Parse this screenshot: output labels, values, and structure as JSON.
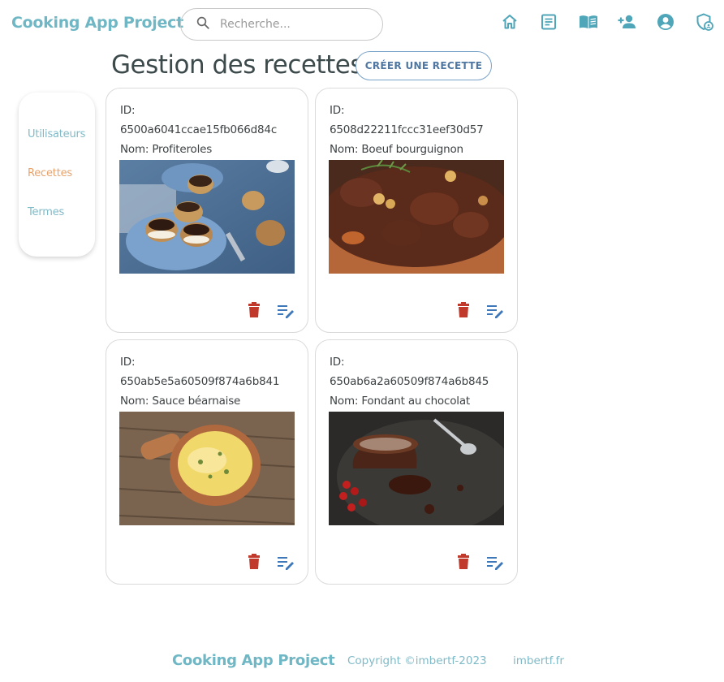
{
  "header": {
    "brand": "Cooking App Project",
    "search": {
      "placeholder": "Recherche..."
    },
    "nav_icons": [
      "home-icon",
      "article-icon",
      "recipe-book-icon",
      "add-user-icon",
      "account-icon",
      "admin-shield-icon"
    ]
  },
  "page": {
    "title": "Gestion des recettes",
    "create_button": "CRÉER UNE RECETTE"
  },
  "sidebar": {
    "items": [
      {
        "label": "Utilisateurs",
        "active": false
      },
      {
        "label": "Recettes",
        "active": true
      },
      {
        "label": "Termes",
        "active": false
      }
    ]
  },
  "recipes": [
    {
      "id_label": "ID:",
      "id": "6500a6041ccae15fb066d84c",
      "name": "Nom: Profiteroles"
    },
    {
      "id_label": "ID:",
      "id": "6508d22211fccc31eef30d57",
      "name": "Nom: Boeuf bourguignon"
    },
    {
      "id_label": "ID:",
      "id": "650ab5e5a60509f874a6b841",
      "name": "Nom: Sauce béarnaise"
    },
    {
      "id_label": "ID:",
      "id": "650ab6a2a60509f874a6b845",
      "name": "Nom: Fondant au chocolat"
    }
  ],
  "footer": {
    "brand": "Cooking App Project",
    "copyright": "Copyright ©imbertf-2023",
    "link": "imbertf.fr"
  },
  "colors": {
    "brand": "#6fb7c4",
    "active": "#e8a26a",
    "delete": "#c0392b",
    "edit": "#3f78b8",
    "button_border": "#7aa3c9"
  }
}
